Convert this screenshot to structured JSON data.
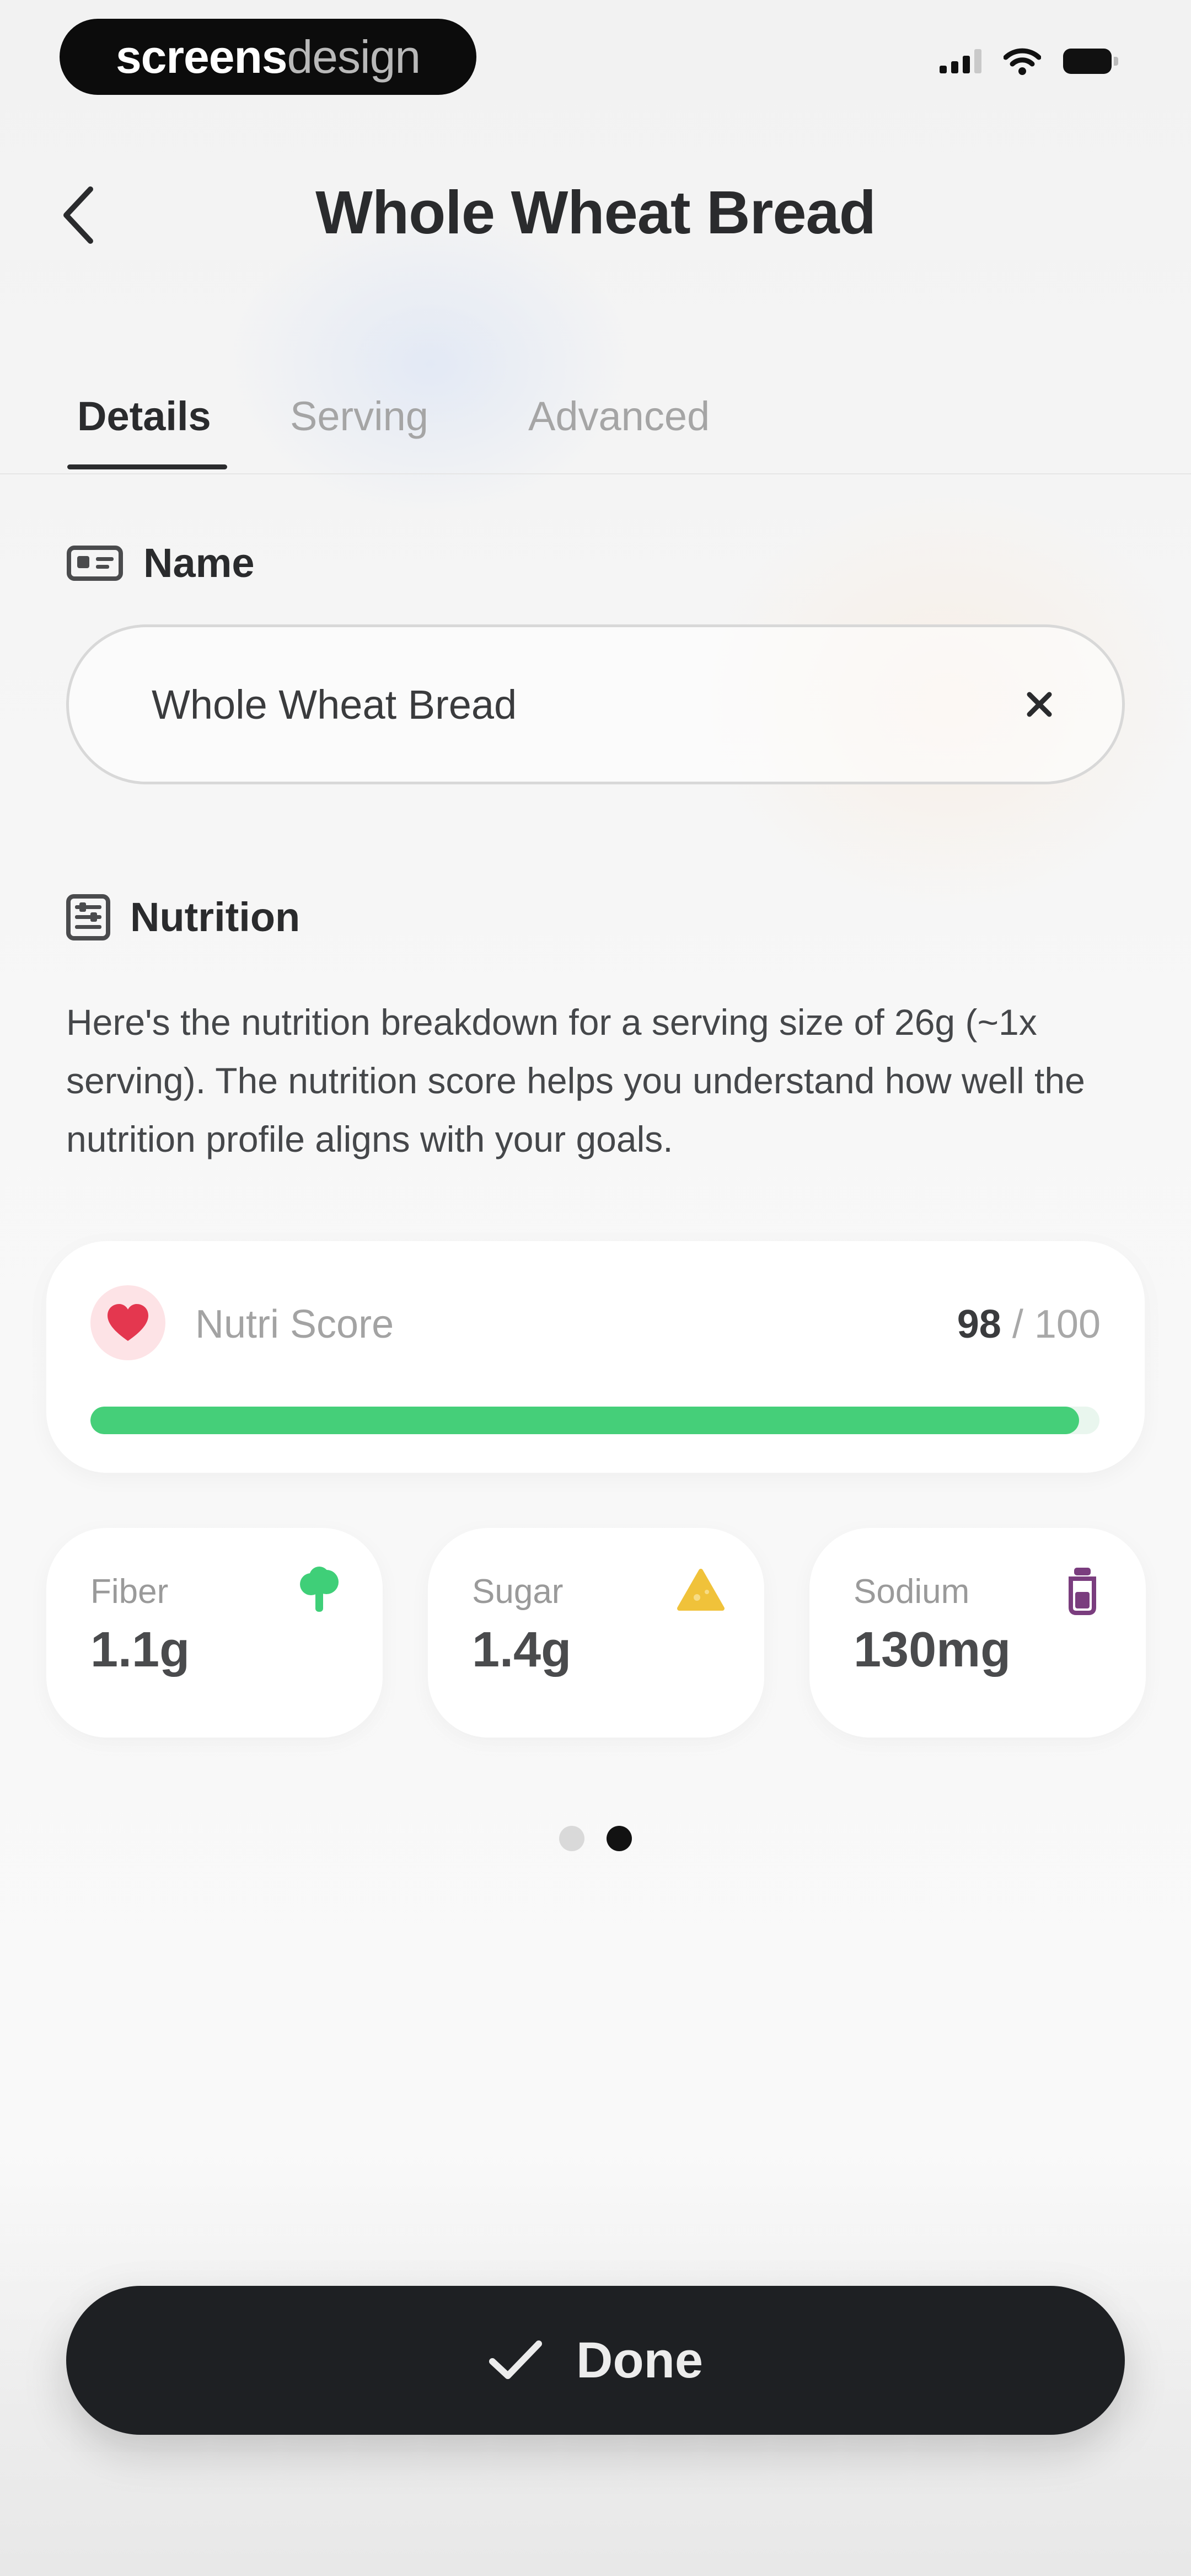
{
  "status_bar": {
    "brand_strong": "screens",
    "brand_light": "design"
  },
  "header": {
    "title": "Whole Wheat Bread"
  },
  "tabs": [
    {
      "label": "Details",
      "active": true
    },
    {
      "label": "Serving",
      "active": false
    },
    {
      "label": "Advanced",
      "active": false
    }
  ],
  "name_section": {
    "heading": "Name",
    "input_value": "Whole Wheat Bread"
  },
  "nutrition_section": {
    "heading": "Nutrition",
    "description": "Here's the nutrition breakdown for a serving size of 26g (~1x serving). The nutrition score helps you understand how well the nutrition profile aligns with your goals."
  },
  "nutri_score": {
    "label": "Nutri Score",
    "score": "98",
    "max": "/ 100",
    "fraction": 0.98
  },
  "stats": [
    {
      "label": "Fiber",
      "value": "1.1g",
      "icon": "broccoli-icon",
      "color": "#3fcf78"
    },
    {
      "label": "Sugar",
      "value": "1.4g",
      "icon": "cheese-wedge-icon",
      "color": "#f0c23a"
    },
    {
      "label": "Sodium",
      "value": "130mg",
      "icon": "salt-shaker-icon",
      "color": "#7a3d7e"
    }
  ],
  "pagination": {
    "current": 2,
    "total": 2
  },
  "footer": {
    "done_label": "Done"
  },
  "colors": {
    "accent_green": "#45cf79",
    "heart_red": "#e4374f",
    "button_dark": "#1e2023"
  }
}
